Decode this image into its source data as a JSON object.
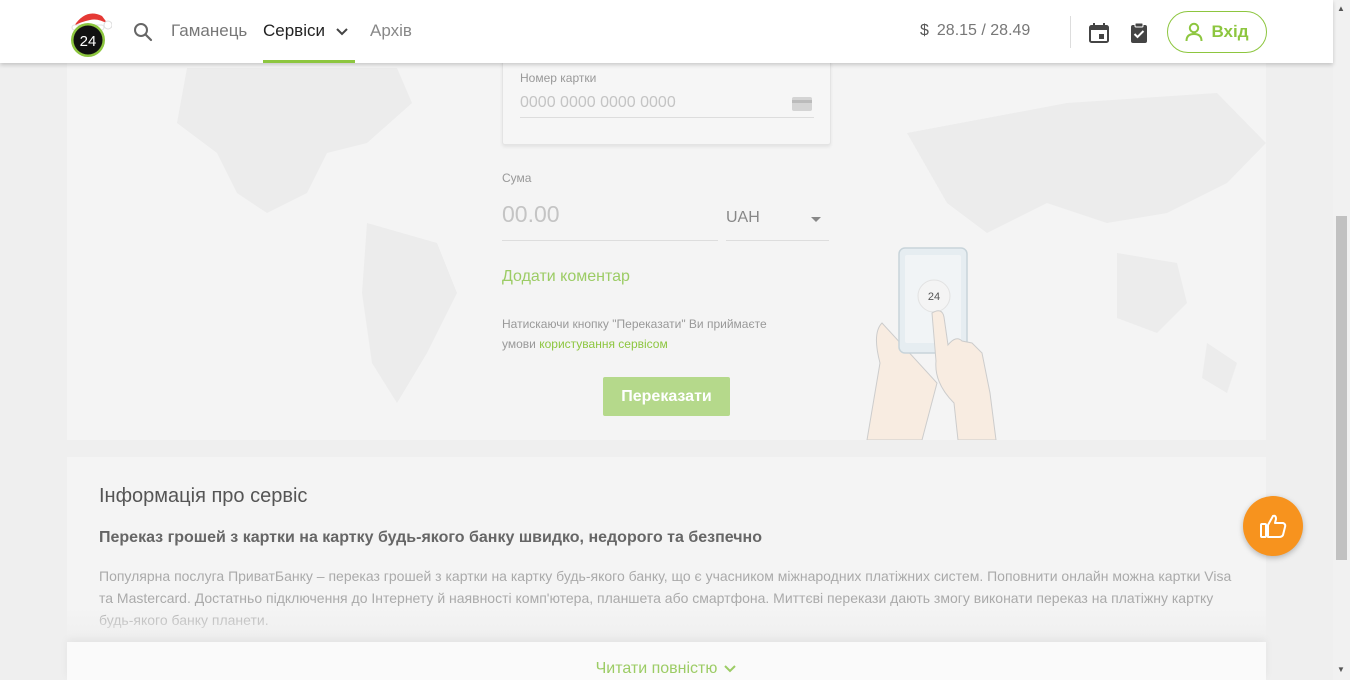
{
  "header": {
    "logo_text": "24",
    "nav": {
      "wallet": "Гаманець",
      "services": "Сервіси",
      "archive": "Архів"
    },
    "rate": {
      "currency_symbol": "$",
      "value": "28.15 / 28.49"
    },
    "login_label": "Вхід",
    "icons": [
      "search-icon",
      "chevron-down-icon",
      "calendar-icon",
      "clipboard-check-icon",
      "user-icon"
    ]
  },
  "form": {
    "card_number_label": "Номер картки",
    "card_number_placeholder": "0000 0000 0000 0000",
    "sum_label": "Сума",
    "sum_placeholder": "00.00",
    "currency": "UAH",
    "add_comment": "Додати коментар",
    "terms_text": "Натискаючи кнопку \"Переказати\" Ви приймаєте умови",
    "terms_link": "користування сервісом",
    "transfer_button": "Переказати",
    "phone_screen_text": "24"
  },
  "info": {
    "title": "Інформація про сервіс",
    "subtitle": "Переказ грошей з картки на картку будь-якого банку швидко, недорого та безпечно",
    "text": "Популярна послуга ПриватБанку – переказ грошей з картки на картку будь-якого банку, що є учасником міжнародних платіжних систем. Поповнити онлайн можна картки Visa та Mastercard. Достатньо підключення до Інтернету й наявності комп'ютера, планшета або смартфона. Миттєві перекази дають змогу виконати переказ на платіжну картку будь-якого банку планети.",
    "read_more": "Читати повністю"
  },
  "colors": {
    "accent": "#8dc63f",
    "accent_light": "#9ccc65",
    "button_disabled": "#b5d98b",
    "feedback_button": "#f7931e"
  }
}
